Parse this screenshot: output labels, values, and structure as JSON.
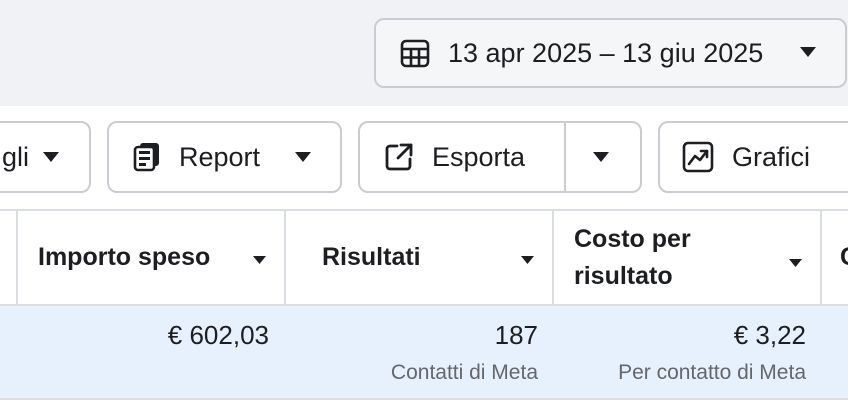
{
  "date_range": {
    "label": "13 apr 2025 – 13 giu 2025"
  },
  "toolbar": {
    "details_label": "gli",
    "report_label": "Report",
    "export_label": "Esporta",
    "charts_label": "Grafici"
  },
  "table": {
    "columns": [
      {
        "label": "Importo speso"
      },
      {
        "label": "Risultati"
      },
      {
        "label": "Costo per risultato"
      },
      {
        "label": "C"
      }
    ],
    "row": {
      "amount_spent": "€ 602,03",
      "results": "187",
      "results_sub": "Contatti di Meta",
      "cost_per_result": "€ 3,22",
      "cost_sub": "Per contatto di Meta"
    }
  },
  "colors": {
    "page_bg": "#f0f2f5",
    "row_highlight": "#e7f0fd",
    "border": "#c9ccd1",
    "text": "#1c1e21",
    "muted_text": "#65676b"
  },
  "icons": [
    "calendar-icon",
    "caret-down-icon",
    "report-icon",
    "export-icon",
    "chart-icon"
  ]
}
